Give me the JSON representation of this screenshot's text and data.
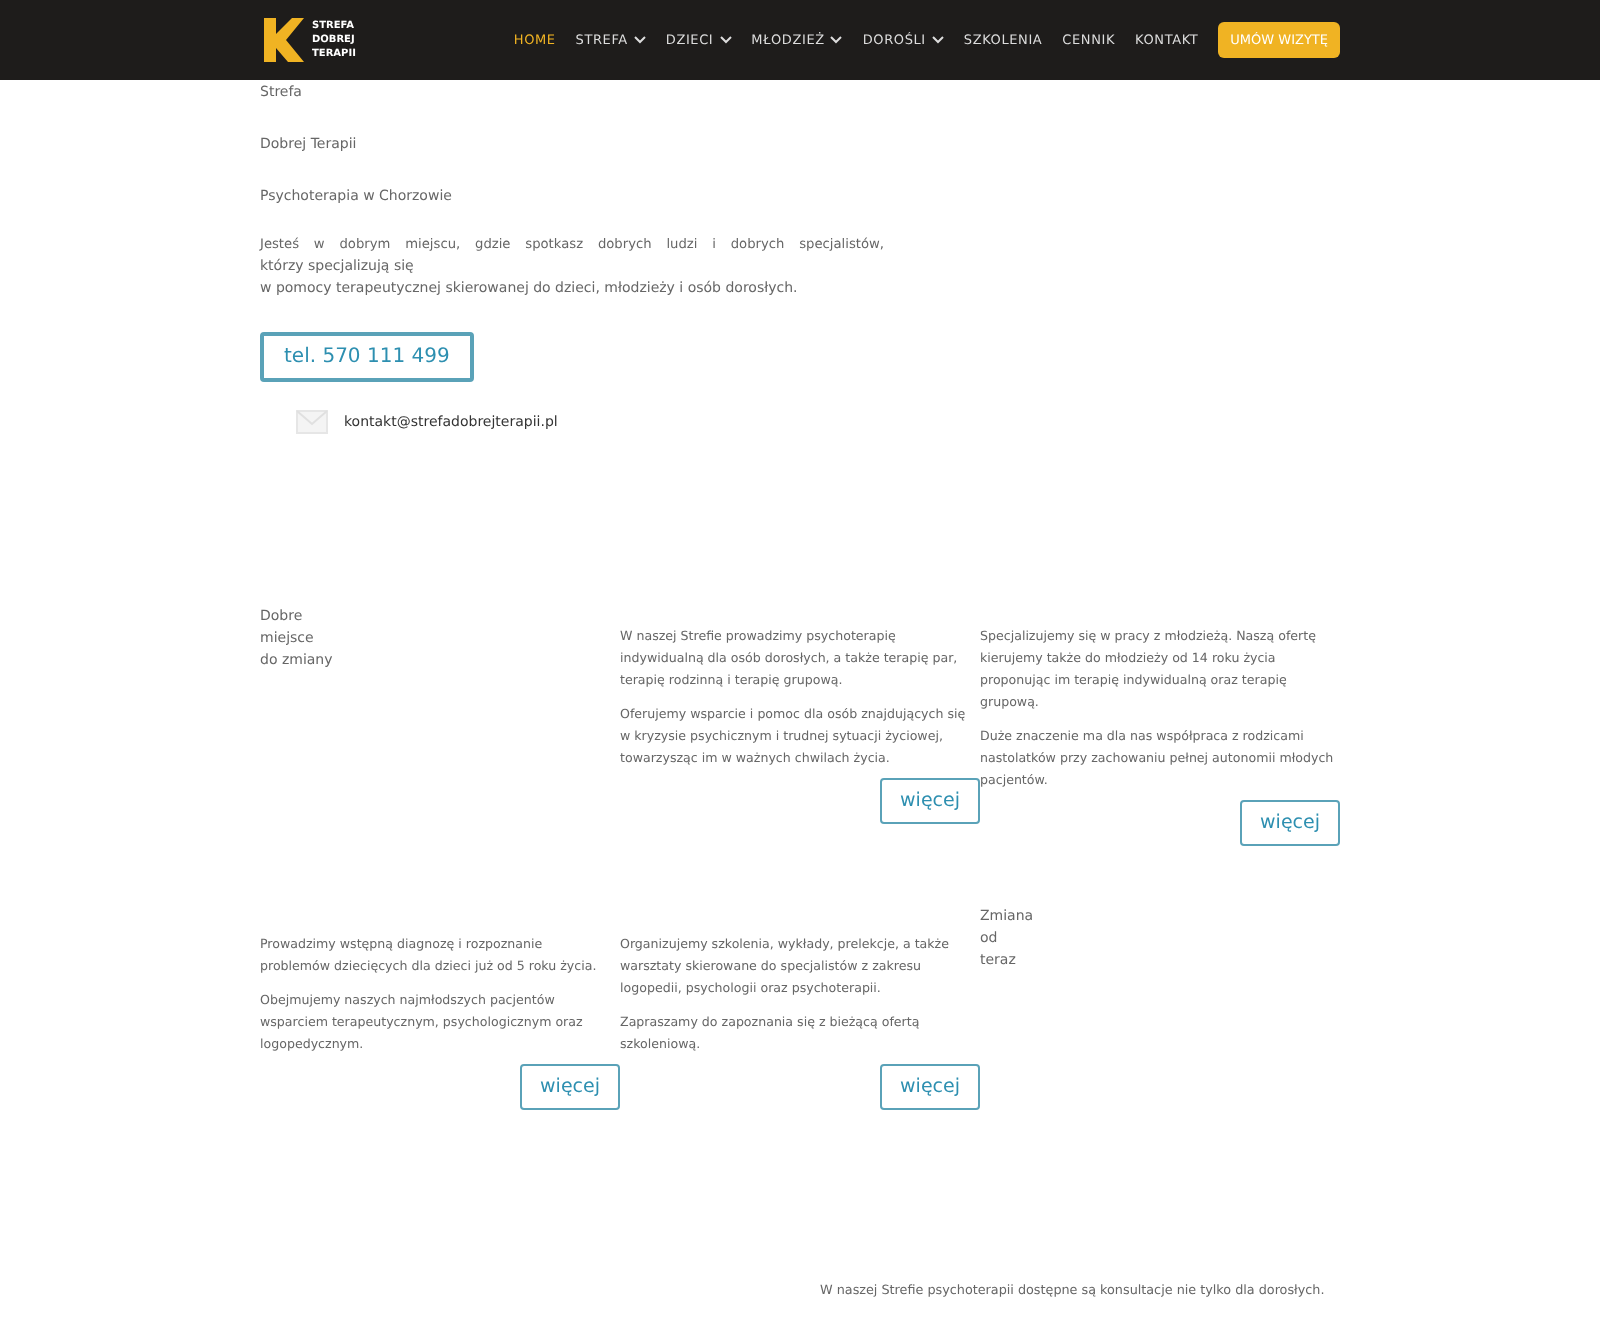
{
  "logo": {
    "lines": [
      "STREFA",
      "DOBREJ",
      "TERAPII"
    ]
  },
  "nav": [
    {
      "label": "HOME",
      "selected": true,
      "dropdown": false
    },
    {
      "label": "STREFA",
      "selected": false,
      "dropdown": true
    },
    {
      "label": "DZIECI",
      "selected": false,
      "dropdown": true
    },
    {
      "label": "MŁODZIEŻ",
      "selected": false,
      "dropdown": true
    },
    {
      "label": "DOROŚLI",
      "selected": false,
      "dropdown": true
    },
    {
      "label": "SZKOLENIA",
      "selected": false,
      "dropdown": false
    },
    {
      "label": "CENNIK",
      "selected": false,
      "dropdown": false
    },
    {
      "label": "KONTAKT",
      "selected": false,
      "dropdown": false
    }
  ],
  "cta": "UMÓW WIZYTĘ",
  "hero": {
    "lines": [
      "Strefa",
      "Dobrej Terapii",
      "Psychoterapia w Chorzowie"
    ],
    "intro": "Jesteś w dobrym miejscu, gdzie spotkasz dobrych ludzi i dobrych specjalistów,",
    "intro_2": "którzy specjalizują się",
    "intro_3": "w pomocy terapeutycznej skierowanej do dzieci, młodzieży i osób dorosłych.",
    "phone": "tel. 570 111 499",
    "email": "kontakt@strefadobrejterapii.pl"
  },
  "row_1": [
    {
      "kind": "heading",
      "lines": [
        "Dobre",
        "miejsce",
        "do zmiany"
      ]
    },
    {
      "kind": "card",
      "paragraphs": [
        "W naszej Strefie prowadzimy psychoterapię indywidualną dla osób dorosłych, a także terapię par, terapię rodzinną i terapię grupową.",
        "Oferujemy wsparcie i pomoc dla osób znajdujących się w kryzysie psychicznym i trudnej sytuacji życiowej, towarzysząc im w ważnych chwilach życia."
      ],
      "button": "więcej"
    },
    {
      "kind": "card",
      "paragraphs": [
        "Specjalizujemy się w pracy z młodzieżą. Naszą ofertę kierujemy także do młodzieży od 14 roku życia proponując im terapię indywidualną oraz terapię grupową.",
        "Duże znaczenie ma dla nas współpraca z rodzicami nastolatków przy zachowaniu pełnej autonomii młodych pacjentów."
      ],
      "button": "więcej"
    }
  ],
  "row_2": [
    {
      "kind": "card",
      "paragraphs": [
        "Prowadzimy wstępną diagnozę i rozpoznanie problemów dziecięcych dla dzieci już od 5 roku życia.",
        "Obejmujemy naszych najmłodszych pacjentów wsparciem terapeutycznym, psychologicznym oraz logopedycznym."
      ],
      "button": "więcej"
    },
    {
      "kind": "card",
      "paragraphs": [
        "Organizujemy szkolenia, wykłady, prelekcje, a także warsztaty skierowane do specjalistów z zakresu logopedii, psychologii oraz psychoterapii.",
        "Zapraszamy do zapoznania się z bieżącą ofertą szkoleniową."
      ],
      "button": "więcej"
    },
    {
      "kind": "heading",
      "lines": [
        "Zmiana",
        "od",
        "teraz"
      ]
    }
  ],
  "footer_text": "W naszej Strefie psychoterapii dostępne są konsultacje nie tylko dla dorosłych."
}
